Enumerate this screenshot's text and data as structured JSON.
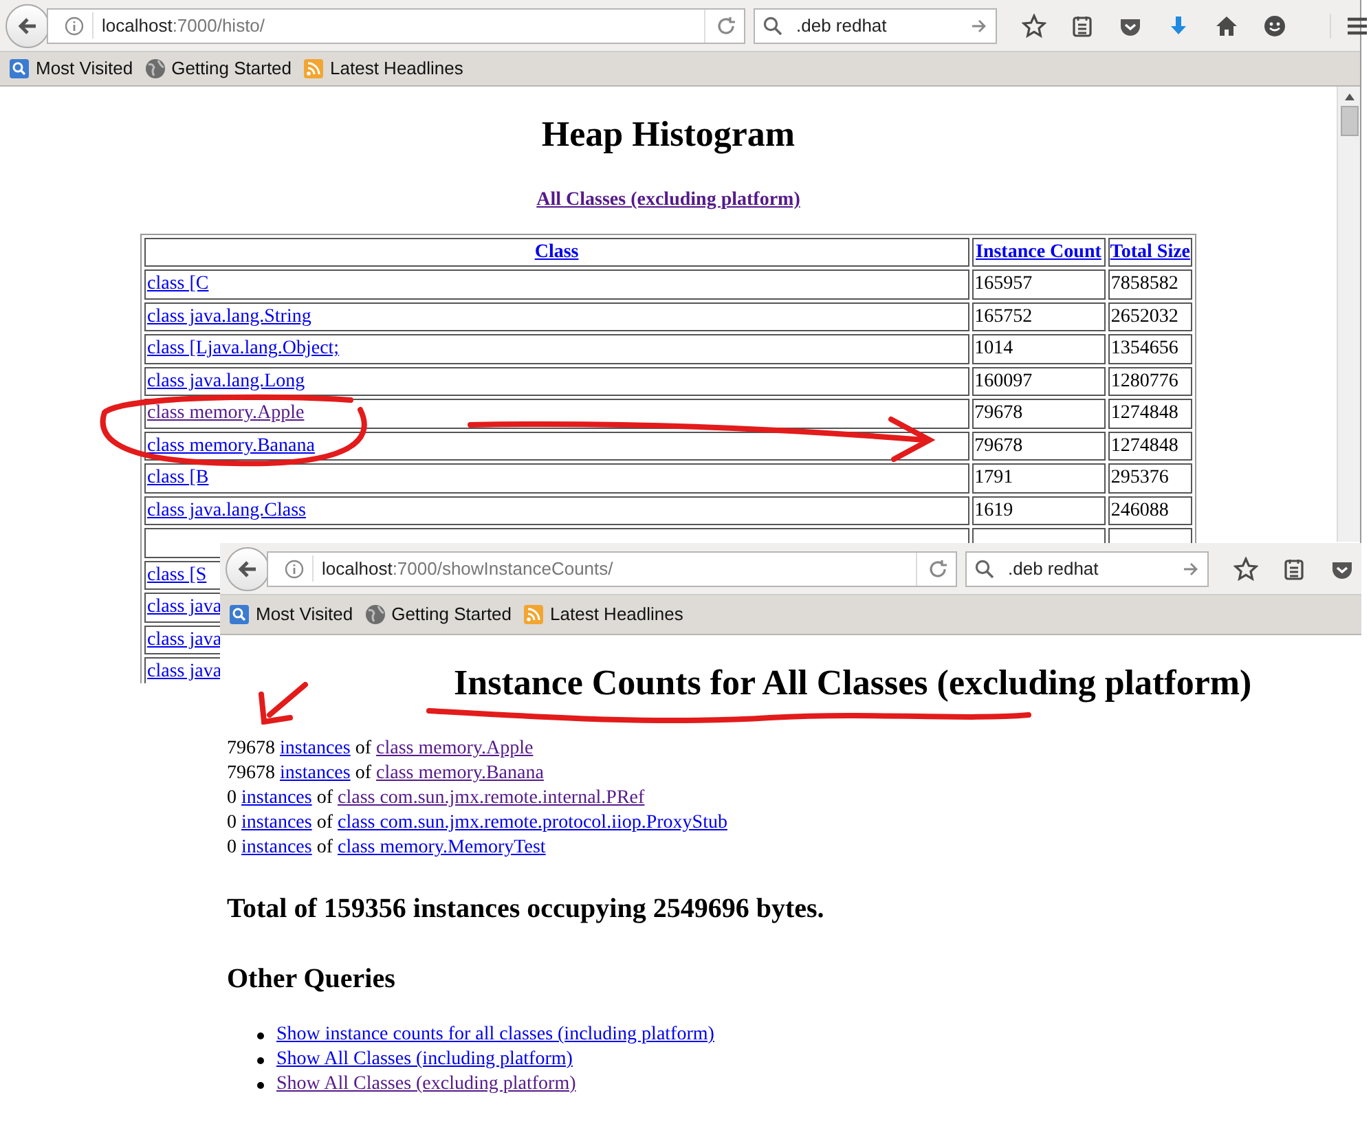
{
  "windows": [
    {
      "url": {
        "host": "localhost",
        "rest": ":7000/histo/"
      },
      "search": {
        "value": ".deb redhat"
      },
      "toolbar_icons": [
        {
          "kind": "star"
        },
        {
          "kind": "reading-list"
        },
        {
          "kind": "pocket"
        },
        {
          "kind": "download"
        },
        {
          "kind": "home"
        },
        {
          "kind": "smiley"
        },
        {
          "kind": "menu"
        }
      ],
      "bookmarks": [
        {
          "label": "Most Visited",
          "kind": "folder"
        },
        {
          "label": "Getting Started",
          "kind": "globe"
        },
        {
          "label": "Latest Headlines",
          "kind": "feed"
        }
      ]
    },
    {
      "url": {
        "host": "localhost",
        "rest": ":7000/showInstanceCounts/"
      },
      "search": {
        "value": ".deb redhat"
      },
      "toolbar_icons": [
        {
          "kind": "star"
        },
        {
          "kind": "reading-list"
        },
        {
          "kind": "pocket"
        }
      ],
      "bookmarks": [
        {
          "label": "Most Visited",
          "kind": "folder"
        },
        {
          "label": "Getting Started",
          "kind": "globe"
        },
        {
          "label": "Latest Headlines",
          "kind": "feed"
        }
      ]
    }
  ],
  "histogram_page": {
    "title": "Heap Histogram",
    "subtitle_link": {
      "text": "All Classes (excluding platform)",
      "visited": true
    },
    "table": {
      "columns": [
        "Class",
        "Instance Count",
        "Total Size"
      ],
      "rows": [
        {
          "class": "class [C",
          "visited": false,
          "count": "165957",
          "size": "7858582"
        },
        {
          "class": "class java.lang.String",
          "visited": false,
          "count": "165752",
          "size": "2652032"
        },
        {
          "class": "class [Ljava.lang.Object;",
          "visited": false,
          "count": "1014",
          "size": "1354656"
        },
        {
          "class": "class java.lang.Long",
          "visited": false,
          "count": "160097",
          "size": "1280776"
        },
        {
          "class": "class memory.Apple",
          "visited": true,
          "count": "79678",
          "size": "1274848"
        },
        {
          "class": "class memory.Banana",
          "visited": false,
          "count": "79678",
          "size": "1274848"
        },
        {
          "class": "class [B",
          "visited": false,
          "count": "1791",
          "size": "295376"
        },
        {
          "class": "class java.lang.Class",
          "visited": false,
          "count": "1619",
          "size": "246088"
        },
        {},
        {
          "class": "class [S",
          "visited": false
        },
        {
          "class": "class java",
          "visited": false
        },
        {
          "class": "class java",
          "visited": false
        },
        {
          "class": "class java",
          "visited": false
        }
      ]
    }
  },
  "instance_counts_page": {
    "heading": "Instance Counts for All Classes (excluding platform)",
    "counts": [
      {
        "count": "79678",
        "link": "instances",
        "joiner": "of",
        "class": "class memory.Apple",
        "visited": true
      },
      {
        "count": "79678",
        "link": "instances",
        "joiner": "of",
        "class": "class memory.Banana",
        "visited": true
      },
      {
        "count": "0",
        "link": "instances",
        "joiner": "of",
        "class": "class com.sun.jmx.remote.internal.PRef",
        "visited": true
      },
      {
        "count": "0",
        "link": "instances",
        "joiner": "of",
        "class": "class com.sun.jmx.remote.protocol.iiop.ProxyStub",
        "visited": false
      },
      {
        "count": "0",
        "link": "instances",
        "joiner": "of",
        "class": "class memory.MemoryTest",
        "visited": false
      }
    ],
    "total": "Total of 159356 instances occupying 2549696 bytes.",
    "other_queries_title": "Other Queries",
    "queries": [
      {
        "text": "Show instance counts for all classes (including platform)",
        "visited": false
      },
      {
        "text": "Show All Classes (including platform)",
        "visited": false
      },
      {
        "text": "Show All Classes (excluding platform)",
        "visited": true
      }
    ]
  }
}
